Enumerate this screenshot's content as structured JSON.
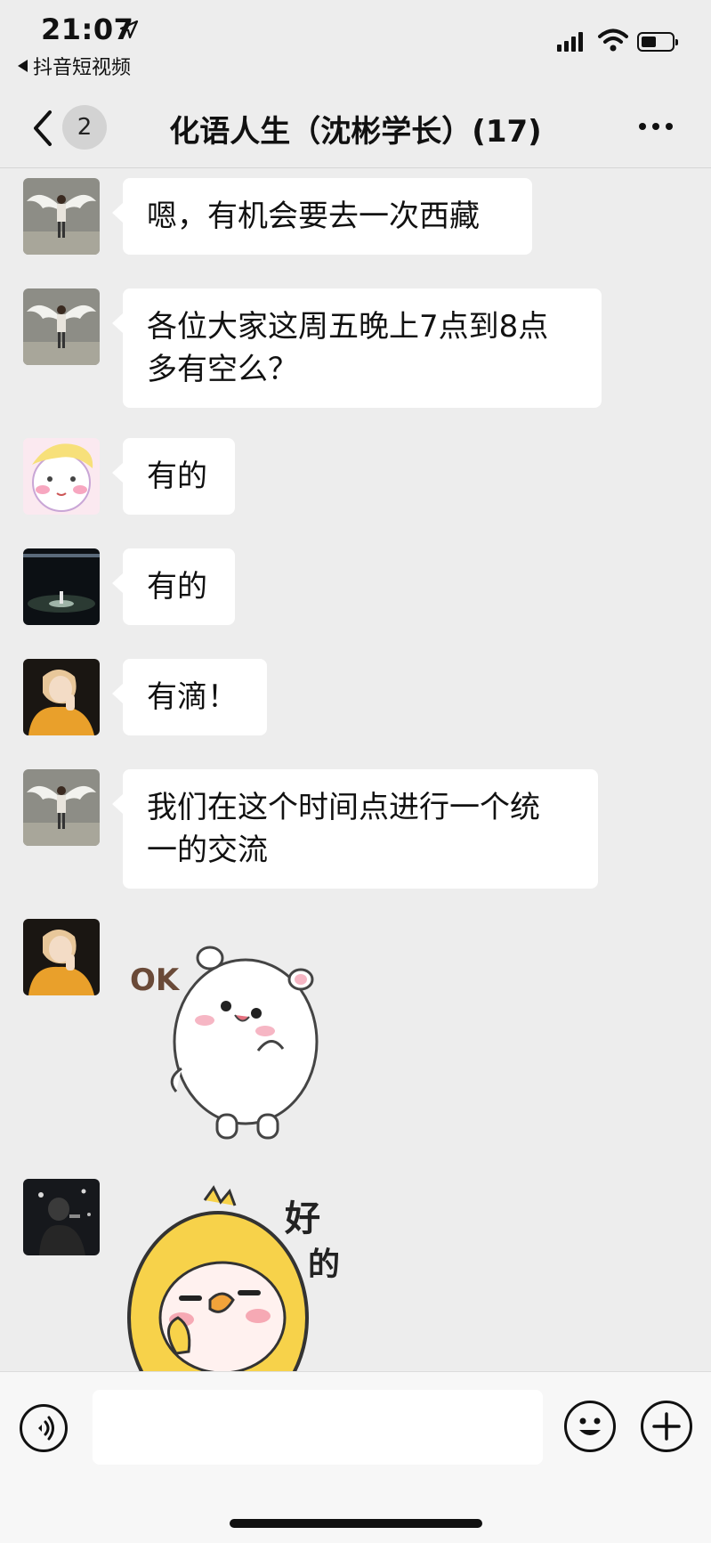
{
  "status_bar": {
    "time": "21:07",
    "back_app_label": "抖音短视频",
    "icons": [
      "location-arrow-icon",
      "signal-icon",
      "wifi-icon",
      "battery-icon"
    ]
  },
  "nav": {
    "unread_count": "2",
    "title": "化语人生（沈彬学长）(17)",
    "icons": [
      "back-chevron-icon",
      "more-icon"
    ]
  },
  "messages": [
    {
      "avatar": "avatar-angel-wings",
      "text": "嗯，有机会要去一次西藏"
    },
    {
      "avatar": "avatar-angel-wings",
      "text_lines": [
        "各位大家这周五晚上7点到8点",
        "多有空么？"
      ]
    },
    {
      "avatar": "avatar-cartoon-girl",
      "text": "有的"
    },
    {
      "avatar": "avatar-dark-stage",
      "text": "有的"
    },
    {
      "avatar": "avatar-yellow-sweater",
      "text": "有滴！"
    },
    {
      "avatar": "avatar-angel-wings",
      "text_lines": [
        "我们在这个时间点进行一个统",
        "一的交流"
      ]
    },
    {
      "avatar": "avatar-yellow-sweater",
      "sticker": "bear-ok-sticker",
      "sticker_text": "OK"
    },
    {
      "avatar": "avatar-dark-concert",
      "sticker": "yellow-chick-sticker",
      "sticker_text_1": "好",
      "sticker_text_2": "的"
    }
  ],
  "input_bar": {
    "placeholder": "",
    "icons": [
      "voice-icon",
      "emoji-icon",
      "plus-icon"
    ]
  },
  "colors": {
    "background": "#ededed",
    "bubble": "#ffffff",
    "input_bar": "#f7f7f7"
  }
}
